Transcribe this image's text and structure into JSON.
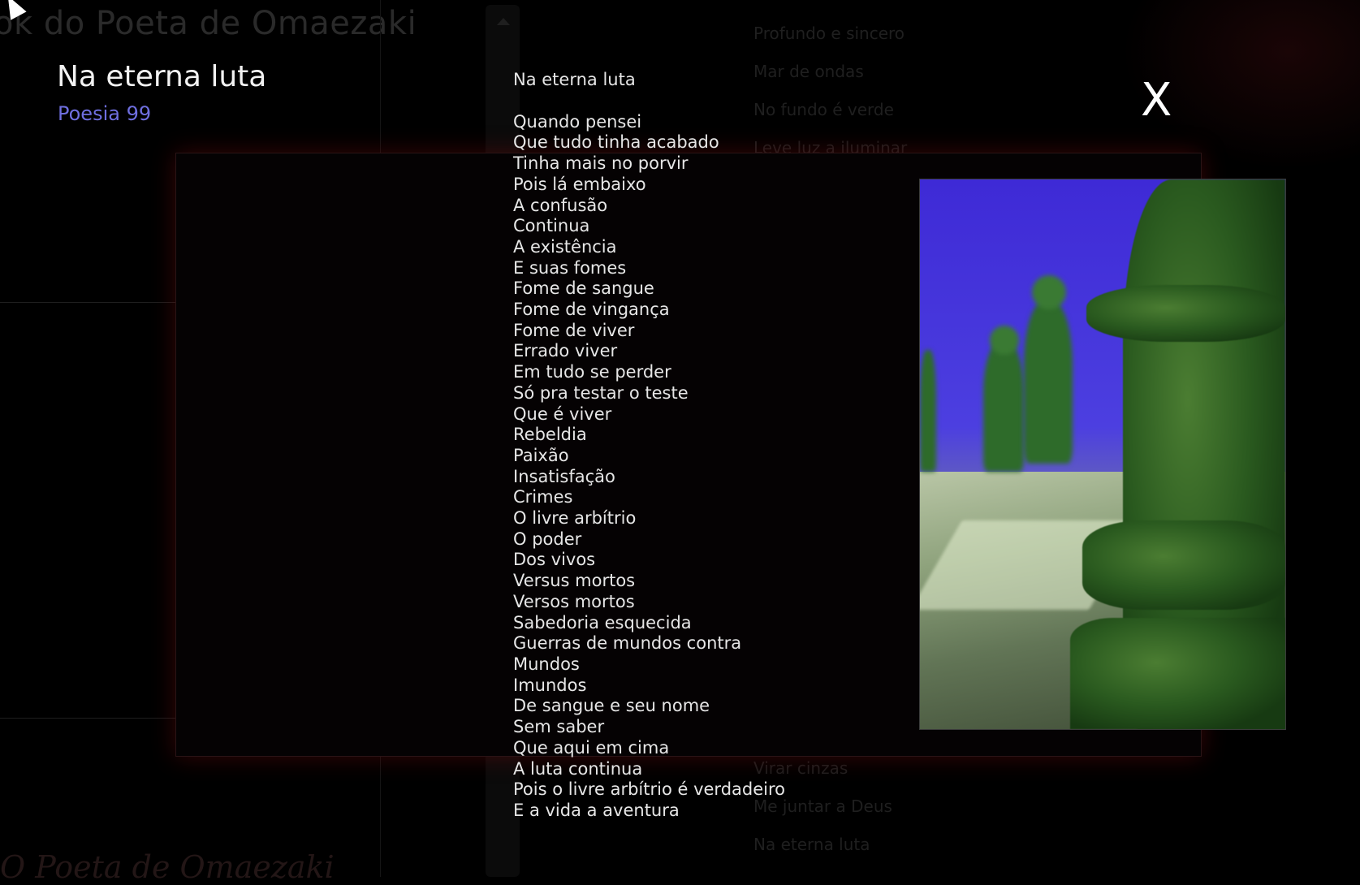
{
  "background": {
    "site_title": "ok do Poeta de Omaezaki",
    "footer_title": "O Poeta de Omaezaki",
    "menu_top": [
      "Profundo e sincero",
      "Mar de ondas",
      "No fundo é verde",
      "Leve luz a iluminar"
    ],
    "menu_bottom": [
      "Virar cinzas",
      "Me juntar a Deus",
      "Na eterna luta"
    ]
  },
  "poem": {
    "title": "Na eterna luta",
    "subtitle": "Poesia 99",
    "heading": "Na eterna luta",
    "lines": [
      "Quando pensei",
      "Que tudo tinha acabado",
      "Tinha mais no porvir",
      "Pois lá embaixo",
      "A confusão",
      "Continua",
      "A existência",
      "E suas fomes",
      "Fome de sangue",
      "Fome de vingança",
      "Fome de viver",
      "Errado viver",
      "Em tudo se perder",
      "Só pra testar o teste",
      "Que é viver",
      "Rebeldia",
      "Paixão",
      "Insatisfação",
      "Crimes",
      "O livre arbítrio",
      "O poder",
      "Dos vivos",
      "Versus mortos",
      "Versos mortos",
      "Sabedoria esquecida",
      "Guerras de mundos contra",
      "Mundos",
      "Imundos",
      "De sangue e seu nome",
      "Sem saber",
      "Que aqui em cima",
      "A luta continua",
      "Pois o livre arbítrio é verdadeiro",
      "E a vida a aventura"
    ]
  },
  "close_label": "X",
  "image": {
    "icon": "chess-pieces-photo"
  }
}
